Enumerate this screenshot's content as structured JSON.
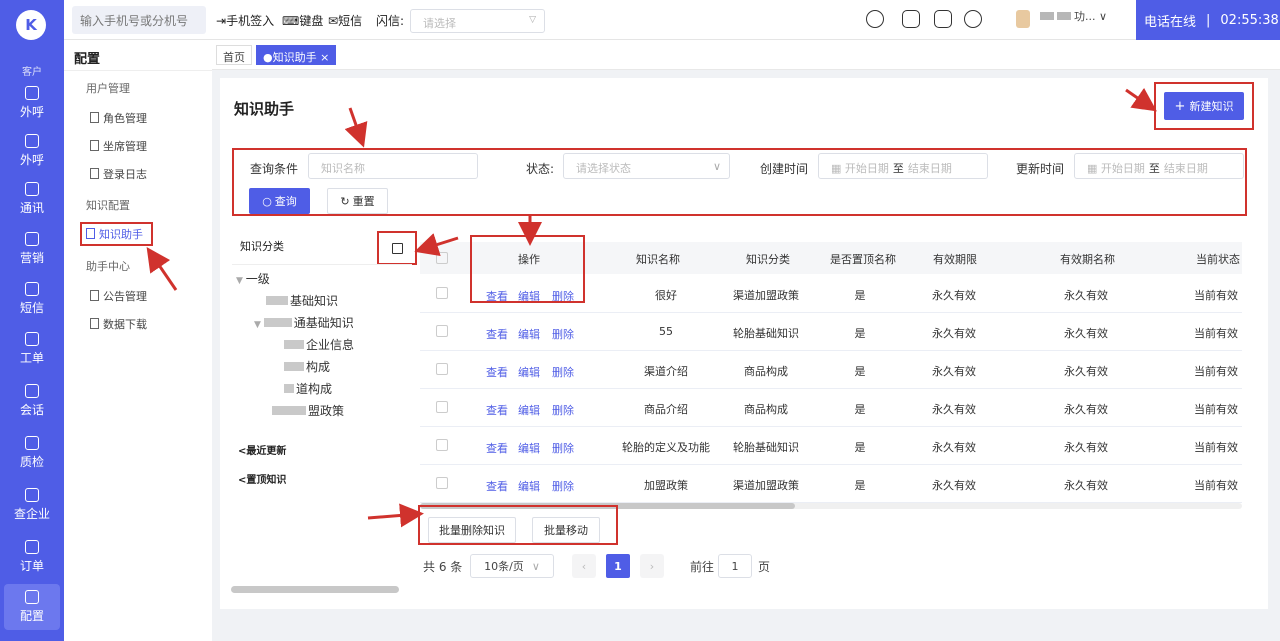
{
  "rail": {
    "logo": "K",
    "items": [
      {
        "label": "外呼",
        "icon": "phone-out-icon"
      },
      {
        "label": "外呼",
        "icon": "phone-out-icon"
      },
      {
        "label": "通讯",
        "icon": "contacts-icon"
      },
      {
        "label": "营销",
        "icon": "marketing-icon"
      },
      {
        "label": "短信",
        "icon": "sms-icon"
      },
      {
        "label": "工单",
        "icon": "clipboard-icon"
      },
      {
        "label": "会话",
        "icon": "chat-icon"
      },
      {
        "label": "质检",
        "icon": "quality-icon"
      },
      {
        "label": "查企业",
        "icon": "building-icon"
      },
      {
        "label": "订单",
        "icon": "order-icon"
      },
      {
        "label": "配置",
        "icon": "settings-icon"
      }
    ]
  },
  "topbar": {
    "phone_placeholder": "输入手机号或分机号",
    "sign_in": "手机签入",
    "keyboard": "键盘",
    "sms": "短信",
    "flash_label": "闪信:",
    "flash_placeholder": "请选择",
    "user_name": "功...",
    "phone_status": "电话在线",
    "timer": "02:55:38"
  },
  "sidebar": {
    "title": "配置",
    "groups": [
      {
        "label": "用户管理",
        "items": [
          "角色管理",
          "坐席管理",
          "登录日志"
        ]
      },
      {
        "label": "知识配置",
        "items": [
          "知识助手"
        ]
      },
      {
        "label": "助手中心",
        "items": [
          "公告管理",
          "数据下载"
        ]
      }
    ]
  },
  "tabs": [
    {
      "label": "首页"
    },
    {
      "label": "知识助手 ×"
    }
  ],
  "page": {
    "title": "知识助手",
    "new_button": "新建知识"
  },
  "filter": {
    "query_label": "查询条件",
    "name_placeholder": "知识名称",
    "status_label": "状态:",
    "status_placeholder": "请选择状态",
    "created_label": "创建时间",
    "updated_label": "更新时间",
    "start_placeholder": "开始日期",
    "to": "至",
    "end_placeholder": "结束日期",
    "search_button": "查询",
    "reset_button": "重置"
  },
  "tree": {
    "title": "知识分类",
    "root": "一级",
    "nodes": [
      "基础知识",
      "通基础知识",
      "企业信息",
      "构成",
      "道构成",
      "盟政策"
    ],
    "recent": "最近更新",
    "pinned": "置顶知识"
  },
  "table": {
    "headers": [
      "操作",
      "知识名称",
      "知识分类",
      "是否置顶名称",
      "有效期限",
      "有效期名称",
      "当前状态"
    ],
    "actions": [
      "查看",
      "编辑",
      "删除"
    ],
    "rows": [
      {
        "name": "很好",
        "category": "渠道加盟政策",
        "pinned": "是",
        "validity": "永久有效",
        "validity_name": "永久有效",
        "status": "当前有效"
      },
      {
        "name": "55",
        "category": "轮胎基础知识",
        "pinned": "是",
        "validity": "永久有效",
        "validity_name": "永久有效",
        "status": "当前有效"
      },
      {
        "name": "渠道介绍",
        "category": "商品构成",
        "pinned": "是",
        "validity": "永久有效",
        "validity_name": "永久有效",
        "status": "当前有效"
      },
      {
        "name": "商品介绍",
        "category": "商品构成",
        "pinned": "是",
        "validity": "永久有效",
        "validity_name": "永久有效",
        "status": "当前有效"
      },
      {
        "name": "轮胎的定义及功能",
        "category": "轮胎基础知识",
        "pinned": "是",
        "validity": "永久有效",
        "validity_name": "永久有效",
        "status": "当前有效"
      },
      {
        "name": "加盟政策",
        "category": "渠道加盟政策",
        "pinned": "是",
        "validity": "永久有效",
        "validity_name": "永久有效",
        "status": "当前有效"
      }
    ]
  },
  "batch": {
    "delete": "批量删除知识",
    "move": "批量移动"
  },
  "pagination": {
    "total": "共 6 条",
    "page_size": "10条/页",
    "current": "1",
    "goto_label": "前往",
    "goto_value": "1",
    "page_unit": "页"
  },
  "colors": {
    "accent": "#4f5de6",
    "annotation": "#d0322d"
  }
}
